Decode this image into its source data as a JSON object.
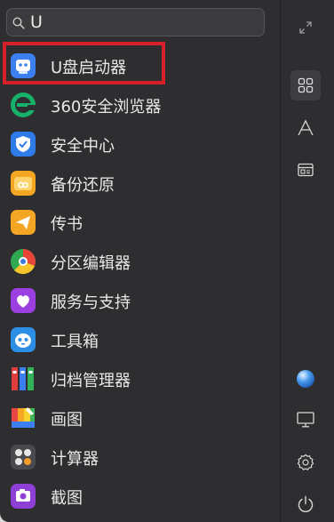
{
  "search": {
    "value": "U",
    "icon": "search-icon"
  },
  "results": [
    {
      "label": "U盘启动器",
      "icon": "usb-launcher-icon",
      "highlighted": true
    },
    {
      "label": "360安全浏览器",
      "icon": "360-browser-icon"
    },
    {
      "label": "安全中心",
      "icon": "security-center-icon"
    },
    {
      "label": "备份还原",
      "icon": "backup-restore-icon"
    },
    {
      "label": "传书",
      "icon": "send-file-icon"
    },
    {
      "label": "分区编辑器",
      "icon": "partition-editor-icon"
    },
    {
      "label": "服务与支持",
      "icon": "service-support-icon"
    },
    {
      "label": "工具箱",
      "icon": "toolbox-icon"
    },
    {
      "label": "归档管理器",
      "icon": "archive-manager-icon"
    },
    {
      "label": "画图",
      "icon": "paint-icon"
    },
    {
      "label": "计算器",
      "icon": "calculator-icon"
    },
    {
      "label": "截图",
      "icon": "screenshot-icon"
    }
  ],
  "sidebar": [
    {
      "icon": "expand-icon"
    },
    {
      "icon": "grid-view-icon",
      "active": true
    },
    {
      "icon": "letter-sort-icon"
    },
    {
      "icon": "category-view-icon"
    },
    {
      "icon": "globe-icon"
    },
    {
      "icon": "monitor-icon"
    },
    {
      "icon": "settings-icon"
    },
    {
      "icon": "power-icon"
    }
  ],
  "colors": {
    "background": "#2e2e31",
    "highlight_border": "#d6202a",
    "text": "#e8e8e8"
  }
}
